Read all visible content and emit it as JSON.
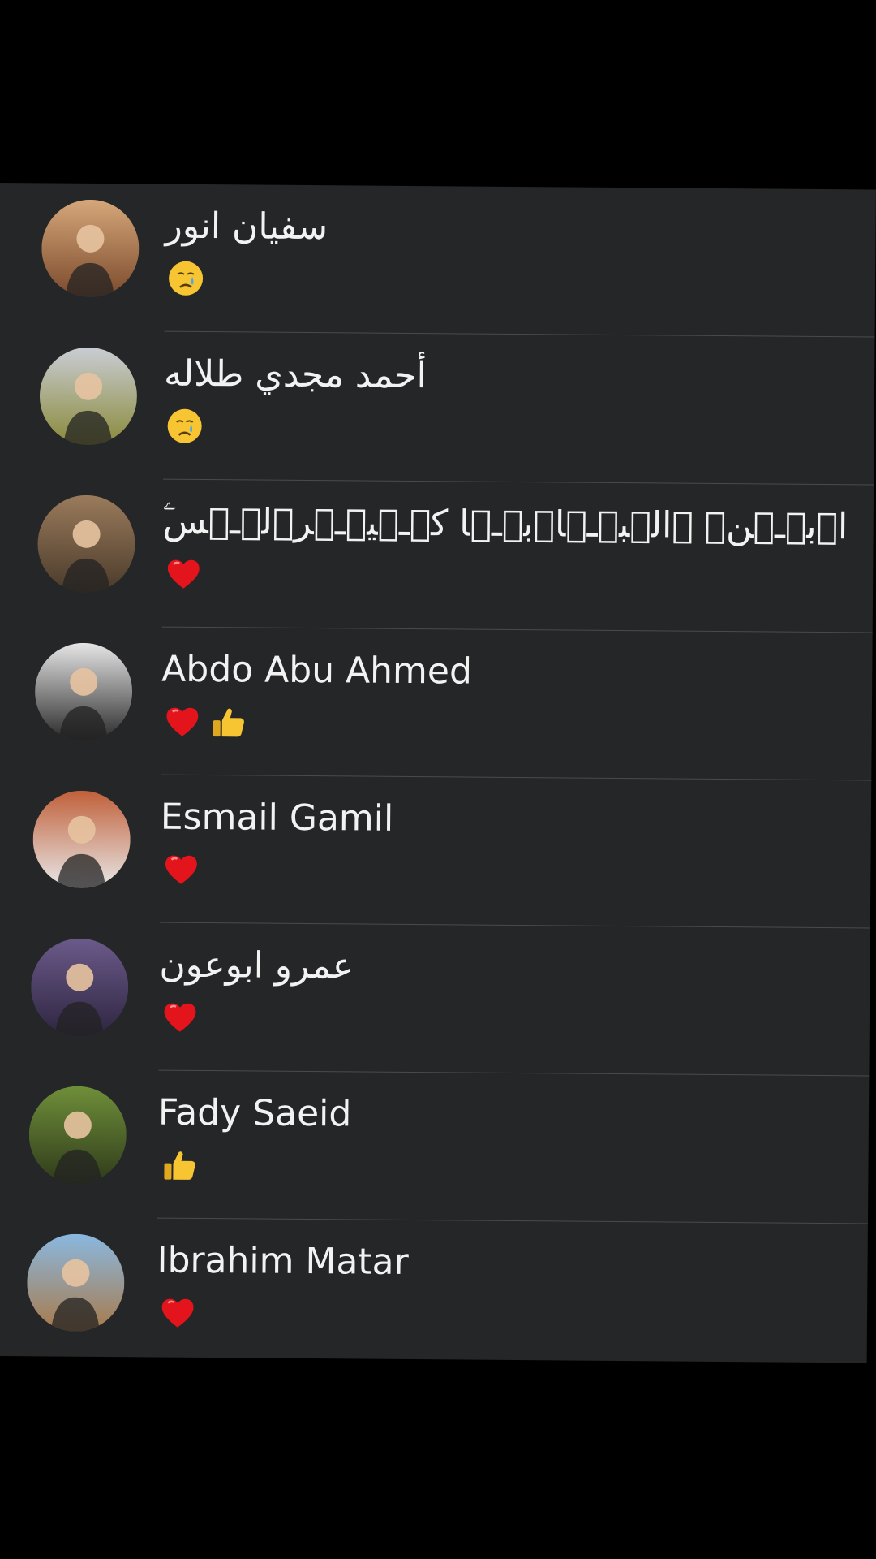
{
  "reactions_list": [
    {
      "name": "سفيان انور",
      "reactions": [
        "crying-face"
      ],
      "avatar_colors": [
        "#d6a77a",
        "#7a4a2c"
      ]
    },
    {
      "name": "أحمد مجدي طلاله",
      "reactions": [
        "crying-face"
      ],
      "avatar_colors": [
        "#c9cdd4",
        "#8a8a3a"
      ]
    },
    {
      "name": "ۧاۛبۜـۨنۨ ۧالۛبۜـۨاۛبۜـۨا كۨـۧيۨـۧرۛلۨـۨس",
      "reactions": [
        "red-heart"
      ],
      "avatar_colors": [
        "#9a7b5c",
        "#4a3a2a"
      ]
    },
    {
      "name": "Abdo Abu Ahmed",
      "reactions": [
        "red-heart",
        "thumbs-up"
      ],
      "avatar_colors": [
        "#e6e6e6",
        "#2a2a2a"
      ]
    },
    {
      "name": "Esmail Gamil",
      "reactions": [
        "red-heart"
      ],
      "avatar_colors": [
        "#c0603a",
        "#e8e8e8"
      ]
    },
    {
      "name": "عمرو ابوعون",
      "reactions": [
        "red-heart"
      ],
      "avatar_colors": [
        "#6b5a8a",
        "#2e2540"
      ]
    },
    {
      "name": "Fady Saeid",
      "reactions": [
        "thumbs-up"
      ],
      "avatar_colors": [
        "#6f8f3a",
        "#2f3a1a"
      ]
    },
    {
      "name": "Ibrahim Matar",
      "reactions": [
        "red-heart"
      ],
      "avatar_colors": [
        "#8ab8e0",
        "#a87a4a"
      ]
    }
  ]
}
